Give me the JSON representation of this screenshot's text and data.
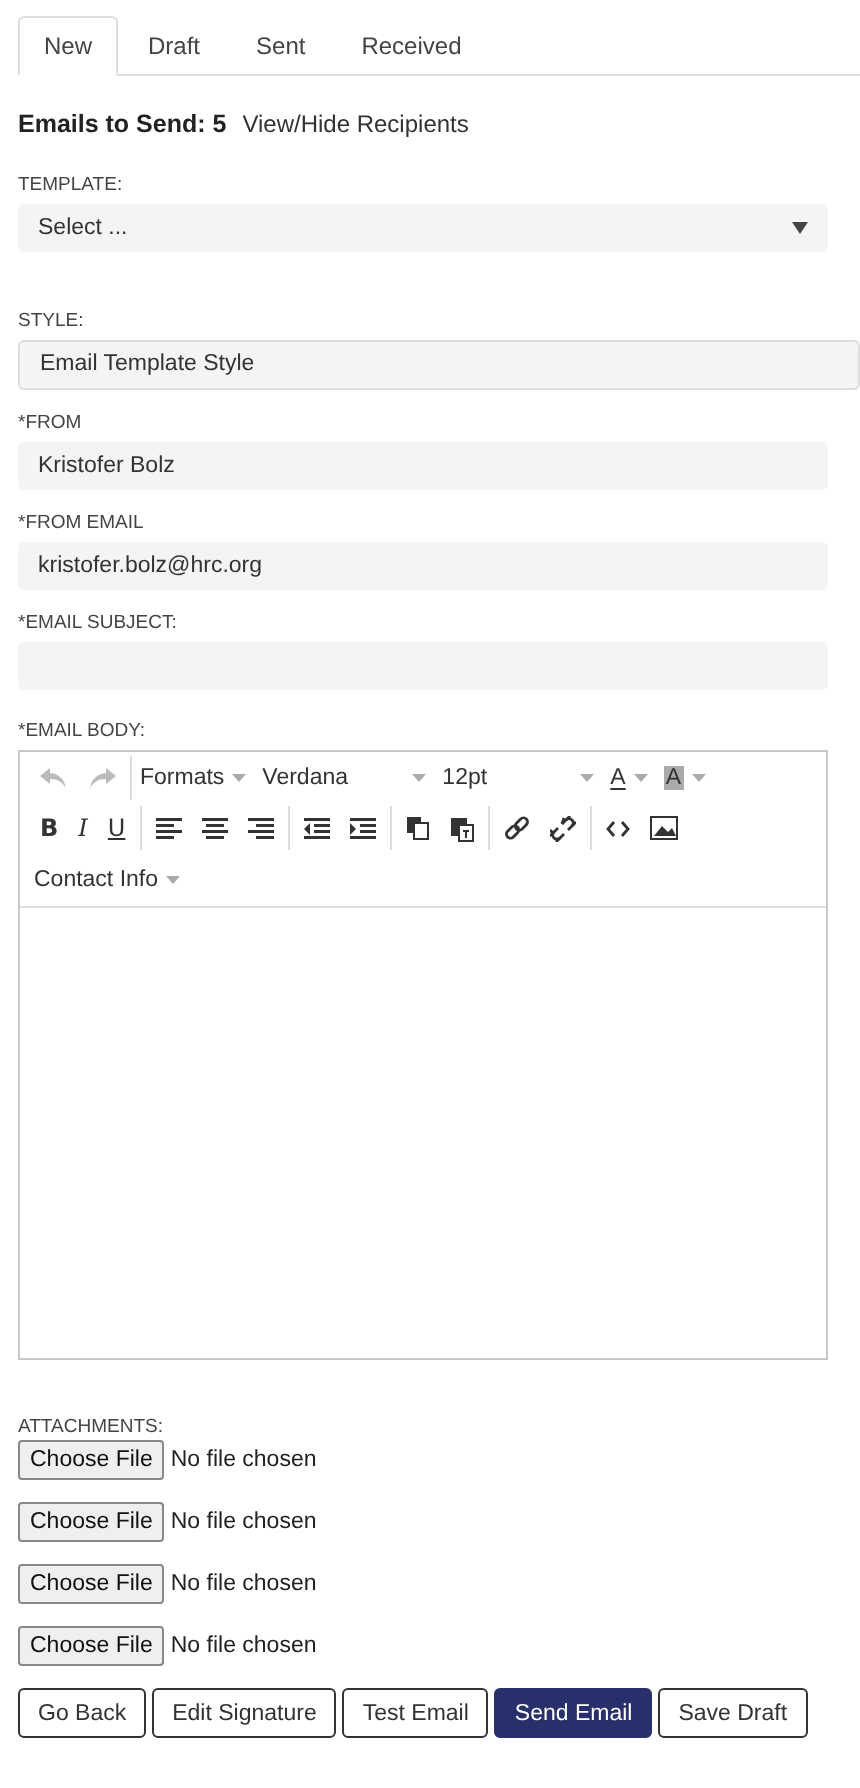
{
  "tabs": [
    {
      "label": "New",
      "selected": true
    },
    {
      "label": "Draft",
      "selected": false
    },
    {
      "label": "Sent",
      "selected": false
    },
    {
      "label": "Received",
      "selected": false
    }
  ],
  "summary": {
    "label": "Emails to Send: 5",
    "link": "View/Hide Recipients"
  },
  "fields": [
    {
      "kind": "select",
      "label": "TEMPLATE:",
      "value": "Select ..."
    },
    {
      "kind": "readonly",
      "label": "STYLE:",
      "value": "Email Template Style"
    },
    {
      "kind": "text",
      "label": "*FROM",
      "value": "Kristofer Bolz"
    },
    {
      "kind": "text",
      "label": "*FROM EMAIL",
      "value": "kristofer.bolz@hrc.org"
    },
    {
      "kind": "text",
      "label": "*EMAIL SUBJECT:"
    }
  ],
  "editor": {
    "label": "*EMAIL BODY:",
    "history": [
      {
        "disabled": true
      },
      {
        "disabled": true
      }
    ],
    "menus": [
      "Formats",
      "Verdana",
      "12pt"
    ],
    "text_color": "A",
    "highlight_color": "A",
    "formatting": [
      "B",
      "I",
      "U"
    ],
    "contact_menu": "Contact Info"
  },
  "attachments": {
    "label": "ATTACHMENTS:",
    "inputs": [
      {
        "button": "Choose File",
        "status": "No file chosen"
      },
      {
        "button": "Choose File",
        "status": "No file chosen"
      },
      {
        "button": "Choose File",
        "status": "No file chosen"
      },
      {
        "button": "Choose File",
        "status": "No file chosen"
      }
    ]
  },
  "buttons": [
    {
      "label": "Go Back",
      "primary": false
    },
    {
      "label": "Edit Signature",
      "primary": false
    },
    {
      "label": "Test Email",
      "primary": false
    },
    {
      "label": "Send Email",
      "primary": true
    },
    {
      "label": "Save Draft",
      "primary": false
    }
  ]
}
